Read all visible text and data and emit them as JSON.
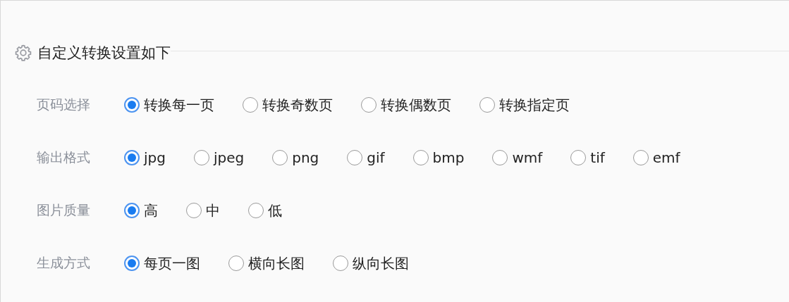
{
  "section": {
    "title": "自定义转换设置如下"
  },
  "groups": [
    {
      "label": "页码选择",
      "options": [
        {
          "label": "转换每一页",
          "selected": true
        },
        {
          "label": "转换奇数页",
          "selected": false
        },
        {
          "label": "转换偶数页",
          "selected": false
        },
        {
          "label": "转换指定页",
          "selected": false
        }
      ]
    },
    {
      "label": "输出格式",
      "options": [
        {
          "label": "jpg",
          "selected": true
        },
        {
          "label": "jpeg",
          "selected": false
        },
        {
          "label": "png",
          "selected": false
        },
        {
          "label": "gif",
          "selected": false
        },
        {
          "label": "bmp",
          "selected": false
        },
        {
          "label": "wmf",
          "selected": false
        },
        {
          "label": "tif",
          "selected": false
        },
        {
          "label": "emf",
          "selected": false
        }
      ]
    },
    {
      "label": "图片质量",
      "options": [
        {
          "label": "高",
          "selected": true
        },
        {
          "label": "中",
          "selected": false
        },
        {
          "label": "低",
          "selected": false
        }
      ]
    },
    {
      "label": "生成方式",
      "options": [
        {
          "label": "每页一图",
          "selected": true
        },
        {
          "label": "横向长图",
          "selected": false
        },
        {
          "label": "纵向长图",
          "selected": false
        }
      ]
    }
  ]
}
